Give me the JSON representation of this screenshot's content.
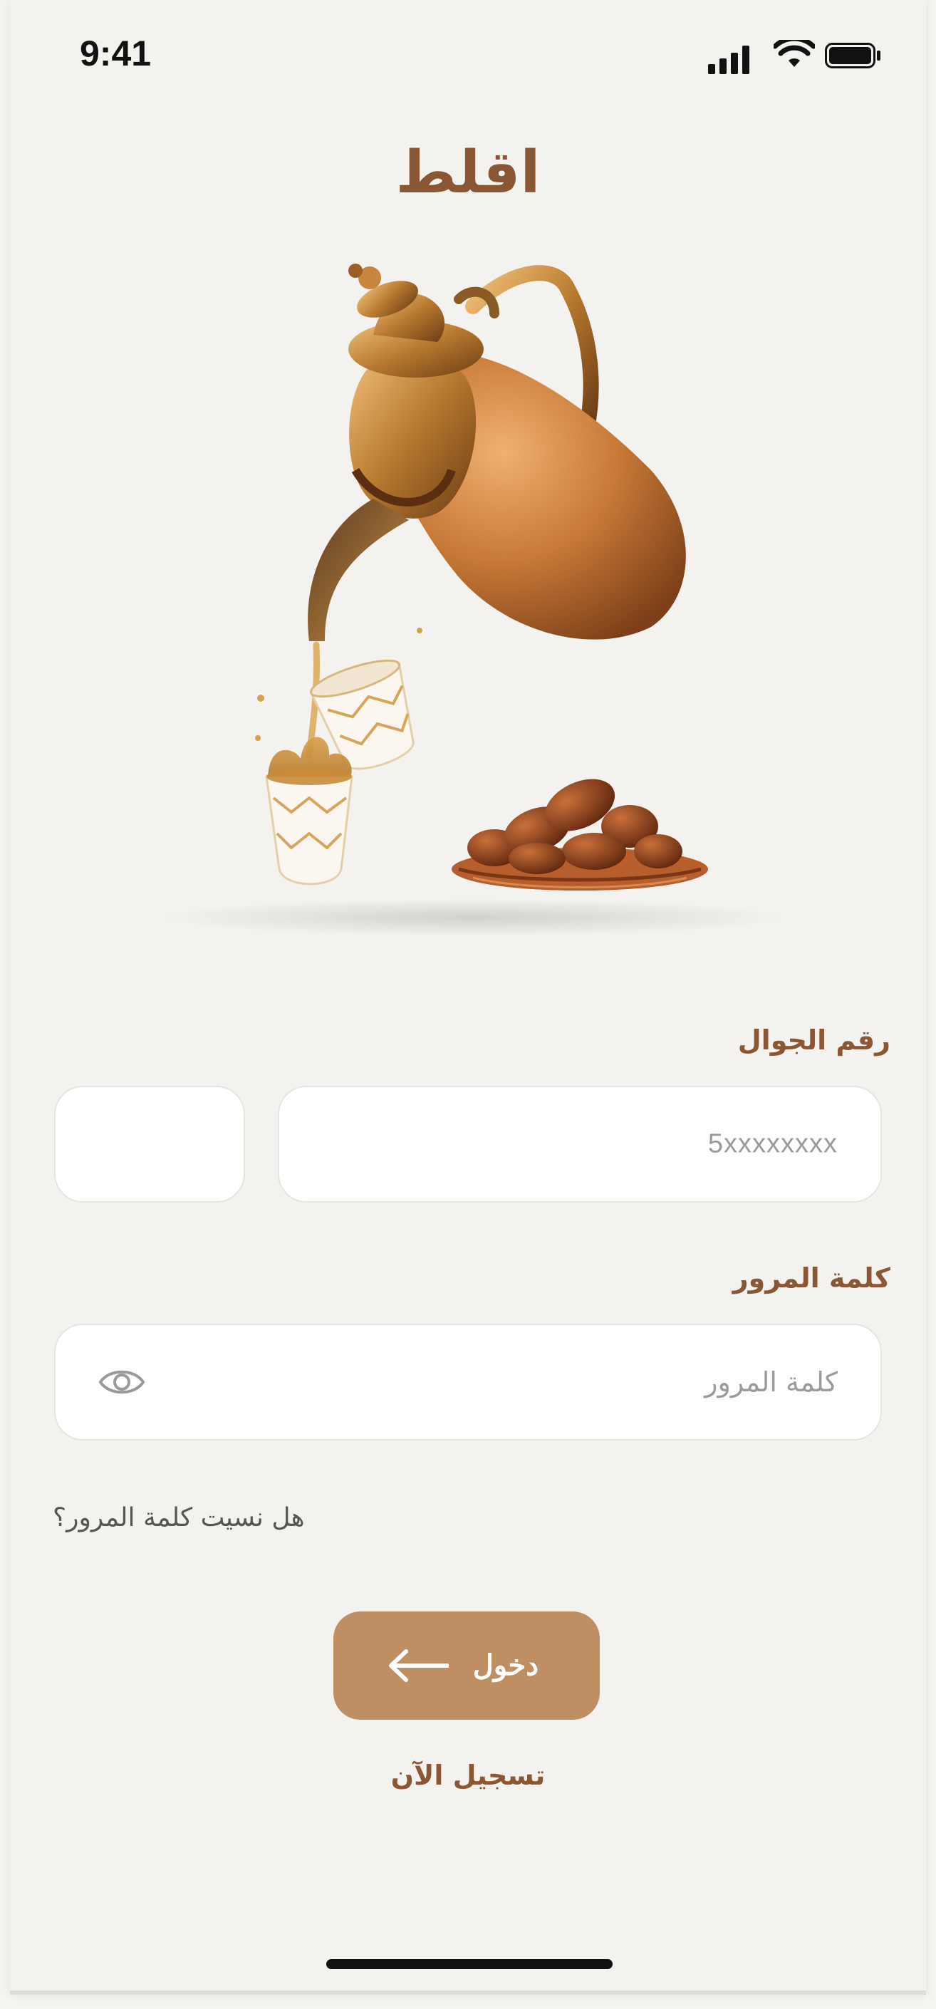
{
  "status_bar": {
    "time": "9:41"
  },
  "app": {
    "title": "اقلط"
  },
  "phone_field": {
    "label": "رقم الجوال",
    "placeholder": "5xxxxxxxx",
    "country_code": ""
  },
  "password_field": {
    "label": "كلمة المرور",
    "placeholder": "كلمة المرور"
  },
  "forgot_password": "هل نسيت كلمة المرور؟",
  "login_button": {
    "label": "دخول"
  },
  "register_link": "تسجيل الآن",
  "colors": {
    "accent": "#bf8f63",
    "brand_text": "#8a5634",
    "background": "#f3f2ee"
  },
  "icons": [
    "signal-icon",
    "wifi-icon",
    "battery-icon",
    "eye-icon",
    "arrow-left-icon"
  ]
}
